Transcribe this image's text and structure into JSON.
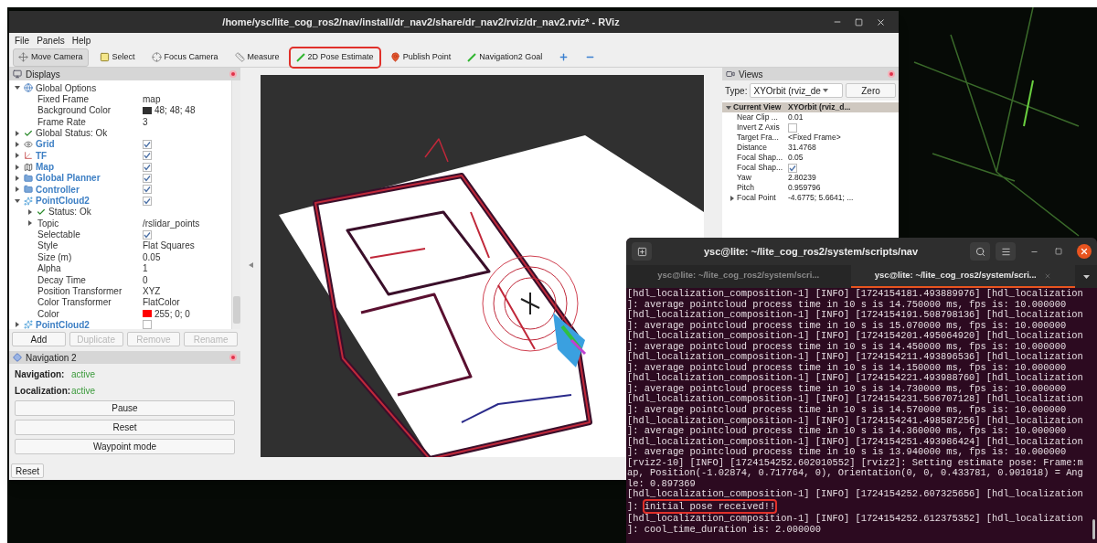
{
  "rviz": {
    "title": "/home/ysc/lite_cog_ros2/nav/install/dr_nav2/share/dr_nav2/rviz/dr_nav2.rviz* - RViz",
    "menu": [
      "File",
      "Panels",
      "Help"
    ],
    "tools": [
      {
        "kind": "move",
        "label": "Move Camera",
        "selected": true,
        "annotated": false
      },
      {
        "kind": "select",
        "label": "Select",
        "selected": false,
        "annotated": false
      },
      {
        "kind": "focus",
        "label": "Focus Camera",
        "selected": false,
        "annotated": false
      },
      {
        "kind": "measure",
        "label": "Measure",
        "selected": false,
        "annotated": false
      },
      {
        "kind": "pose",
        "label": "2D Pose Estimate",
        "selected": false,
        "annotated": true
      },
      {
        "kind": "point",
        "label": "Publish Point",
        "selected": false,
        "annotated": false
      },
      {
        "kind": "goal",
        "label": "Navigation2 Goal",
        "selected": false,
        "annotated": false
      },
      {
        "kind": "add",
        "selected": false,
        "annotated": false
      },
      {
        "kind": "remove",
        "selected": false,
        "annotated": false
      }
    ],
    "displays": {
      "title": "Displays",
      "items": [
        {
          "kind": "options",
          "label": "Global Options",
          "expanded": true,
          "children": [
            {
              "kind": "property",
              "label": "Fixed Frame",
              "value": "map"
            },
            {
              "kind": "property",
              "label": "Background Color",
              "value": "48; 48; 48",
              "color": "#303030"
            },
            {
              "kind": "property",
              "label": "Frame Rate",
              "value": "3"
            }
          ]
        },
        {
          "kind": "status",
          "label": "Global Status: Ok",
          "expanded": false
        },
        {
          "kind": "grid",
          "label": "Grid",
          "expanded": false,
          "checked": true
        },
        {
          "kind": "tf",
          "label": "TF",
          "expanded": false,
          "checked": true
        },
        {
          "kind": "map",
          "label": "Map",
          "expanded": false,
          "checked": true
        },
        {
          "kind": "folder",
          "label": "Global Planner",
          "expanded": false,
          "checked": true
        },
        {
          "kind": "folder",
          "label": "Controller",
          "expanded": false,
          "checked": true
        },
        {
          "kind": "pointcloud",
          "label": "PointCloud2",
          "expanded": true,
          "checked": true,
          "children": [
            {
              "kind": "status",
              "label": "Status: Ok",
              "expanded": false
            },
            {
              "kind": "property",
              "label": "Topic",
              "value": "/rslidar_points",
              "expanded": false
            },
            {
              "kind": "property",
              "label": "Selectable",
              "checked": true
            },
            {
              "kind": "property",
              "label": "Style",
              "value": "Flat Squares"
            },
            {
              "kind": "property",
              "label": "Size (m)",
              "value": "0.05"
            },
            {
              "kind": "property",
              "label": "Alpha",
              "value": "1"
            },
            {
              "kind": "property",
              "label": "Decay Time",
              "value": "0"
            },
            {
              "kind": "property",
              "label": "Position Transformer",
              "value": "XYZ"
            },
            {
              "kind": "property",
              "label": "Color Transformer",
              "value": "FlatColor"
            },
            {
              "kind": "property",
              "label": "Color",
              "value": "255; 0; 0",
              "color": "#ff0000"
            }
          ]
        },
        {
          "kind": "pointcloud",
          "label": "PointCloud2",
          "expanded": false,
          "checked": false
        }
      ],
      "buttons": [
        {
          "label": "Add",
          "disabled": false
        },
        {
          "label": "Duplicate",
          "disabled": true
        },
        {
          "label": "Remove",
          "disabled": true
        },
        {
          "label": "Rename",
          "disabled": true
        }
      ]
    },
    "navigation": {
      "title": "Navigation 2",
      "status": [
        {
          "label": "Navigation:",
          "value": "active"
        },
        {
          "label": "Localization:",
          "value": "active"
        }
      ],
      "buttons": [
        "Pause",
        "Reset",
        "Waypoint mode"
      ]
    },
    "bottom_button": "Reset",
    "views": {
      "title": "Views",
      "type_label": "Type:",
      "type_value": "XYOrbit (rviz_de",
      "zero_button": "Zero",
      "current": {
        "label": "Current View",
        "value": "XYOrbit (rviz_d...",
        "expanded": true,
        "children": [
          {
            "label": "Near Clip ...",
            "value": "0.01"
          },
          {
            "label": "Invert Z Axis",
            "checked": false
          },
          {
            "label": "Target Fra...",
            "value": "<Fixed Frame>"
          },
          {
            "label": "Distance",
            "value": "31.4768"
          },
          {
            "label": "Focal Shap...",
            "value": "0.05"
          },
          {
            "label": "Focal Shap...",
            "checked": true
          },
          {
            "label": "Yaw",
            "value": "2.80239"
          },
          {
            "label": "Pitch",
            "value": "0.959796"
          },
          {
            "label": "Focal Point",
            "value": "-4.6775; 5.6641; ...",
            "expanded": false
          }
        ]
      }
    }
  },
  "terminal": {
    "title": "ysc@lite: ~/lite_cog_ros2/system/scripts/nav",
    "tabs": [
      {
        "label": "ysc@lite: ~/lite_cog_ros2/system/scri...",
        "selected": false
      },
      {
        "label": "ysc@lite: ~/lite_cog_ros2/system/scri...",
        "selected": true
      }
    ],
    "lines": [
      {
        "text": "[hdl_localization_composition-1] [INFO] [1724154181.493889976] [hdl_localization"
      },
      {
        "text": "]: average pointcloud process time in 10 s is 14.750000 ms, fps is: 10.000000"
      },
      {
        "text": "[hdl_localization_composition-1] [INFO] [1724154191.508798136] [hdl_localization"
      },
      {
        "text": "]: average pointcloud process time in 10 s is 15.070000 ms, fps is: 10.000000"
      },
      {
        "text": "[hdl_localization_composition-1] [INFO] [1724154201.495064920] [hdl_localization"
      },
      {
        "text": "]: average pointcloud process time in 10 s is 14.450000 ms, fps is: 10.000000"
      },
      {
        "text": "[hdl_localization_composition-1] [INFO] [1724154211.493896536] [hdl_localization"
      },
      {
        "text": "]: average pointcloud process time in 10 s is 14.150000 ms, fps is: 10.000000"
      },
      {
        "text": "[hdl_localization_composition-1] [INFO] [1724154221.493988760] [hdl_localization"
      },
      {
        "text": "]: average pointcloud process time in 10 s is 14.730000 ms, fps is: 10.000000"
      },
      {
        "text": "[hdl_localization_composition-1] [INFO] [1724154231.506707128] [hdl_localization"
      },
      {
        "text": "]: average pointcloud process time in 10 s is 14.570000 ms, fps is: 10.000000"
      },
      {
        "text": "[hdl_localization_composition-1] [INFO] [1724154241.498587256] [hdl_localization"
      },
      {
        "text": "]: average pointcloud process time in 10 s is 14.360000 ms, fps is: 10.000000"
      },
      {
        "text": "[hdl_localization_composition-1] [INFO] [1724154251.493986424] [hdl_localization"
      },
      {
        "text": "]: average pointcloud process time in 10 s is 13.940000 ms, fps is: 10.000000"
      },
      {
        "text": "[rviz2-10] [INFO] [1724154252.602010552] [rviz2]: Setting estimate pose: Frame:m"
      },
      {
        "text": "ap, Position(-1.02874, 0.717764, 0), Orientation(0, 0, 0.433781, 0.901018) = Ang"
      },
      {
        "text": "le: 0.897369"
      },
      {
        "text": "[hdl_localization_composition-1] [INFO] [1724154252.607325656] [hdl_localization"
      },
      {
        "text": "]: ",
        "marked": "initial pose received!!"
      },
      {
        "text": "[hdl_localization_composition-1] [INFO] [1724154252.612375352] [hdl_localization"
      },
      {
        "text": "]: cool_time_duration is: 2.000000"
      }
    ]
  }
}
